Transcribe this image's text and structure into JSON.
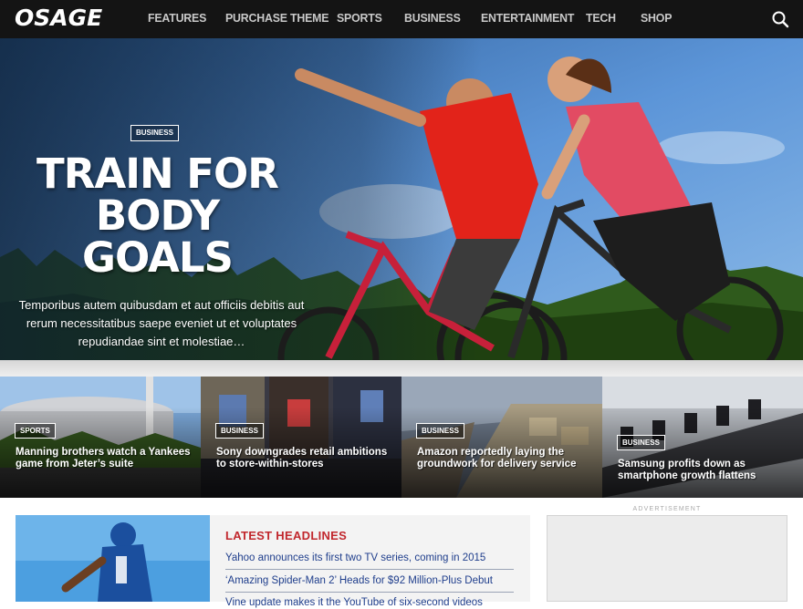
{
  "site": {
    "logo": "OSAGE"
  },
  "nav": {
    "items": [
      {
        "label": "FEATURES"
      },
      {
        "label": "PURCHASE THEME"
      },
      {
        "label": "SPORTS"
      },
      {
        "label": "BUSINESS"
      },
      {
        "label": "ENTERTAINMENT"
      },
      {
        "label": "TECH"
      },
      {
        "label": "SHOP"
      }
    ],
    "search_icon": "search-icon"
  },
  "hero": {
    "category": "BUSINESS",
    "title_lines": [
      "TRAIN FOR",
      "BODY",
      "GOALS"
    ],
    "excerpt": "Temporibus autem quibusdam et aut officiis debitis aut rerum necessitatibus saepe eveniet ut et voluptates repudiandae sint et molestiae…"
  },
  "cards": [
    {
      "category": "SPORTS",
      "title": "Manning brothers watch a Yankees game from Jeter’s suite"
    },
    {
      "category": "BUSINESS",
      "title": "Sony downgrades retail ambitions to store-within-stores"
    },
    {
      "category": "BUSINESS",
      "title": "Amazon reportedly laying the groundwork for delivery service"
    },
    {
      "category": "BUSINESS",
      "title": "Samsung profits down as smartphone growth flattens"
    }
  ],
  "headlines": {
    "title": "LATEST HEADLINES",
    "items": [
      "Yahoo announces its first two TV series, coming in 2015",
      "‘Amazing Spider-Man 2’ Heads for $92 Million-Plus Debut",
      "Vine update makes it the YouTube of six-second videos"
    ]
  },
  "advertisement": {
    "label": "ADVERTISEMENT"
  },
  "colors": {
    "nav_bg": "#141414",
    "headline_red": "#c1272d",
    "link_blue": "#1f3e8c"
  }
}
